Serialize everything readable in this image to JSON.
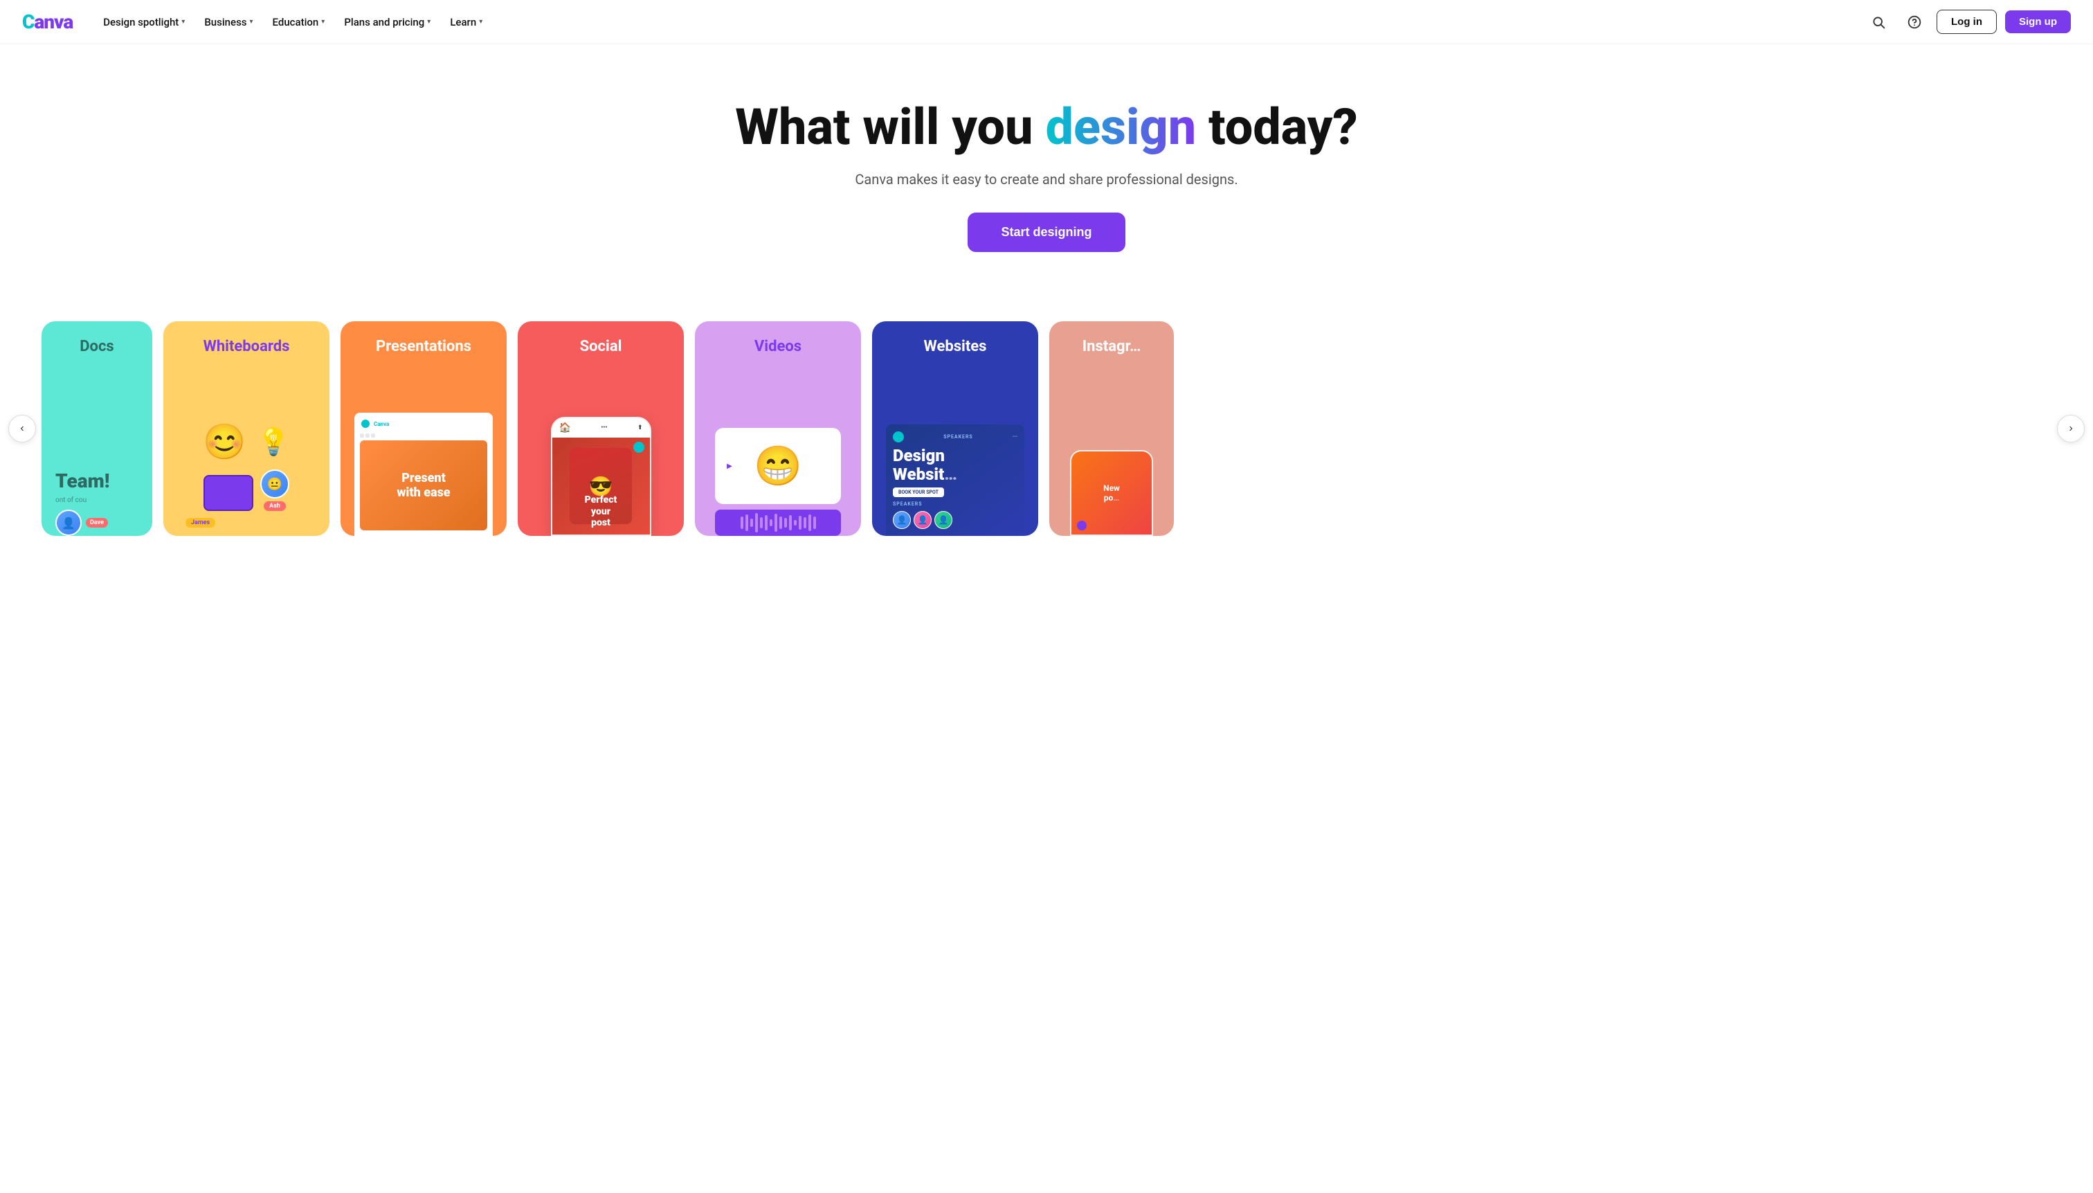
{
  "brand": {
    "logo_c": "C",
    "logo_rest": "anva",
    "logo_color_c": "#00C4CC",
    "logo_color_rest": "#7C3AED"
  },
  "nav": {
    "items": [
      {
        "label": "Design spotlight",
        "id": "design-spotlight"
      },
      {
        "label": "Business",
        "id": "business"
      },
      {
        "label": "Education",
        "id": "education"
      },
      {
        "label": "Plans and pricing",
        "id": "plans-pricing"
      },
      {
        "label": "Learn",
        "id": "learn"
      }
    ],
    "search_aria": "Search",
    "help_aria": "Help",
    "login_label": "Log in",
    "signup_label": "Sign up"
  },
  "hero": {
    "title_part1": "What will you ",
    "title_highlight": "design",
    "title_part2": " today?",
    "subtitle": "Canva makes it easy to create and share professional designs.",
    "cta_label": "Start designing"
  },
  "carousel": {
    "nav_left": "‹",
    "nav_right": "›",
    "cards": [
      {
        "id": "docs",
        "title": "Docs",
        "bg": "#5CE8D4",
        "title_color": "#2D6A63",
        "illustration_text": "Team!"
      },
      {
        "id": "whiteboards",
        "title": "Whiteboards",
        "bg": "#FFD166",
        "title_color": "#7C3AED"
      },
      {
        "id": "presentations",
        "title": "Presentations",
        "bg": "#FF8C42",
        "title_color": "#fff",
        "slide_text": "Present with ease"
      },
      {
        "id": "social",
        "title": "Social",
        "bg": "#F75C5C",
        "title_color": "#fff",
        "phone_text": "Perfect your post"
      },
      {
        "id": "videos",
        "title": "Videos",
        "bg": "#D8A0F0",
        "title_color": "#7C3AED"
      },
      {
        "id": "websites",
        "title": "Websites",
        "bg": "#2D3CB0",
        "title_color": "#fff",
        "ws_title": "Design Websit…",
        "ws_btn_label": "BOOK YOUR SPOT",
        "ws_speakers_label": "SPEAKERS"
      },
      {
        "id": "instagram",
        "title": "Instagr…",
        "bg": "#E8A090",
        "title_color": "#fff"
      }
    ]
  }
}
